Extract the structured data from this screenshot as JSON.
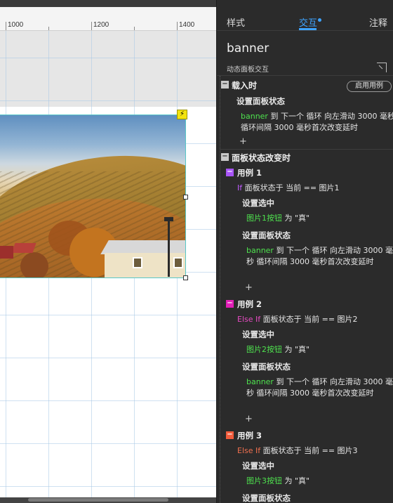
{
  "canvas": {
    "ruler_labels": [
      "1000",
      "1200",
      "1400"
    ]
  },
  "inspector": {
    "tabs": [
      {
        "label": "样式"
      },
      {
        "label": "交互"
      },
      {
        "label": "注释"
      }
    ],
    "active_tab": "交互",
    "accent_color": "#3ea3ff",
    "widget_name": "banner",
    "subheader": "动态面板交互",
    "load_event": {
      "title": "载入时",
      "enable_case_button": "启用用例",
      "action_title": "设置面板状态",
      "target": "banner",
      "action_text": " 到 下一个 循环 向左滑动 3000 毫秒 循环间隔 3000 毫秒首次改变延时",
      "add": "+"
    },
    "state_change_event": {
      "title": "面板状态改变时",
      "cases": [
        {
          "label": "用例 1",
          "color": "#a855f7",
          "condition_keyword": "If",
          "condition_keyword_color": "#c05cff",
          "condition": " 面板状态于 当前 == 图片1",
          "select_title": "设置选中",
          "select_target": "图片1按钮",
          "select_value": " 为 \"真\"",
          "panel_title": "设置面板状态",
          "panel_target": "banner",
          "panel_text": " 到 下一个 循环 向左滑动 3000 毫秒 循环间隔 3000 毫秒首次改变延时",
          "add": "+"
        },
        {
          "label": "用例 2",
          "color": "#e21fb7",
          "condition_keyword": "Else If",
          "condition_keyword_color": "#e64bc2",
          "condition": " 面板状态于 当前 == 图片2",
          "select_title": "设置选中",
          "select_target": "图片2按钮",
          "select_value": " 为 \"真\"",
          "panel_title": "设置面板状态",
          "panel_target": "banner",
          "panel_text": " 到 下一个 循环 向左滑动 3000 毫秒 循环间隔 3000 毫秒首次改变延时",
          "add": "+"
        },
        {
          "label": "用例 3",
          "color": "#f25c3c",
          "condition_keyword": "Else If",
          "condition_keyword_color": "#f0704f",
          "condition": " 面板状态于 当前 == 图片3",
          "select_title": "设置选中",
          "select_target": "图片3按钮",
          "select_value": " 为 \"真\"",
          "panel_title": "设置面板状态"
        }
      ]
    },
    "icons": {
      "collapse": "collapse-corner-icon",
      "event_toggle": "minus-square-icon",
      "lightning": "lightning-icon",
      "dropdown": "caret-down-icon"
    }
  }
}
